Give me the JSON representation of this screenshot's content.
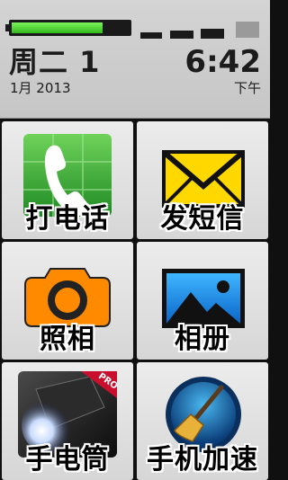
{
  "status": {
    "battery_level": 0.78,
    "battery_color": "#34b81e",
    "signal_icon": "signal-bars-icon"
  },
  "clock": {
    "weekday_day": "周二 1",
    "month_year": "1月 2013",
    "time": "6:42",
    "ampm": "下午"
  },
  "tiles": [
    {
      "label": "打电话",
      "icon": "phone-icon"
    },
    {
      "label": "发短信",
      "icon": "envelope-icon"
    },
    {
      "label": "照相",
      "icon": "camera-icon"
    },
    {
      "label": "相册",
      "icon": "gallery-icon"
    },
    {
      "label": "手电筒",
      "icon": "flashlight-icon",
      "badge": "PRO"
    },
    {
      "label": "手机加速",
      "icon": "broom-booster-icon"
    }
  ]
}
